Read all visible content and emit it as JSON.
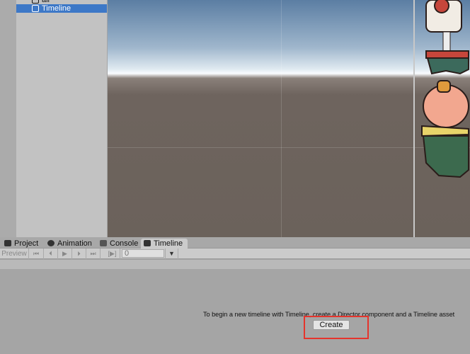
{
  "hierarchy": {
    "items": [
      {
        "label": "all",
        "selected": false
      },
      {
        "label": "Timeline",
        "selected": true
      }
    ]
  },
  "tabs": [
    {
      "label": "Project",
      "icon": "folder-icon"
    },
    {
      "label": "Animation",
      "icon": "animation-icon"
    },
    {
      "label": "Console",
      "icon": "console-icon"
    },
    {
      "label": "Timeline",
      "icon": "timeline-icon",
      "active": true
    }
  ],
  "toolbar": {
    "preview": "Preview",
    "first": "⏮",
    "prev": "⏴",
    "play": "▶",
    "next": "⏵",
    "last": "⏭",
    "playrange": "[▶]",
    "time": "0",
    "dropdown": "▼"
  },
  "timeline": {
    "message": "To begin a new timeline with Timeline, create a Director component and a Timeline asset",
    "create": "Create"
  },
  "colors": {
    "selection": "#3d78c7",
    "highlight": "#e5342c"
  }
}
